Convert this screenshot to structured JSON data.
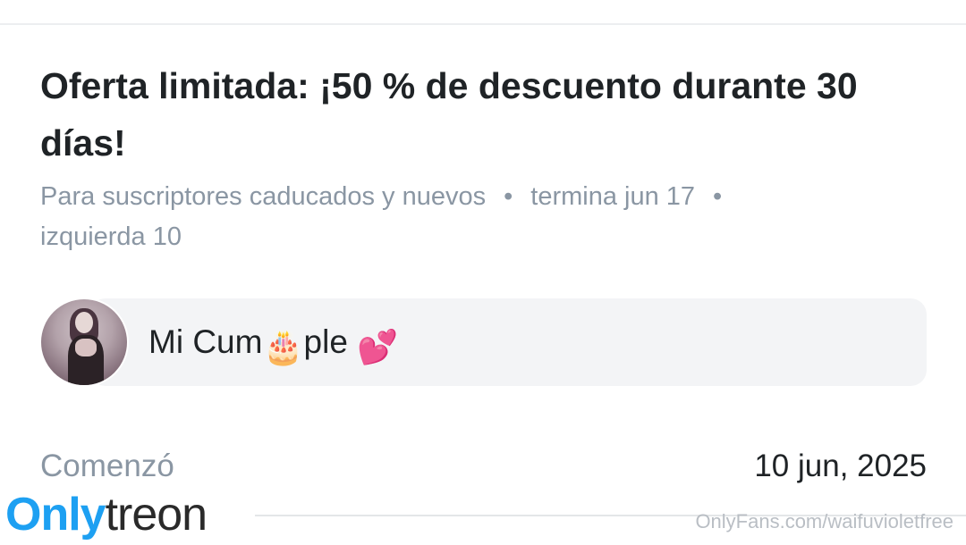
{
  "offer": {
    "title": "Oferta limitada: ¡50 % de descuento durante 30 días!",
    "audience": "Para suscriptores caducados y nuevos",
    "separator": "•",
    "ends": "termina jun 17",
    "remaining": "izquierda 10"
  },
  "message": {
    "text_before": "Mi Cum",
    "emoji_cake": "🎂",
    "text_after": "ple",
    "emoji_hearts": "💕"
  },
  "started": {
    "label": "Comenzó",
    "date": "10 jun, 2025"
  },
  "watermark": {
    "logo_part_1": "Only",
    "logo_part_2": "treon",
    "url": "OnlyFans.com/waifuvioletfree"
  },
  "colors": {
    "text_primary": "#1f2326",
    "text_secondary": "#8a96a3",
    "bubble_bg": "#f3f4f6",
    "logo_blue": "#1da0f2"
  }
}
